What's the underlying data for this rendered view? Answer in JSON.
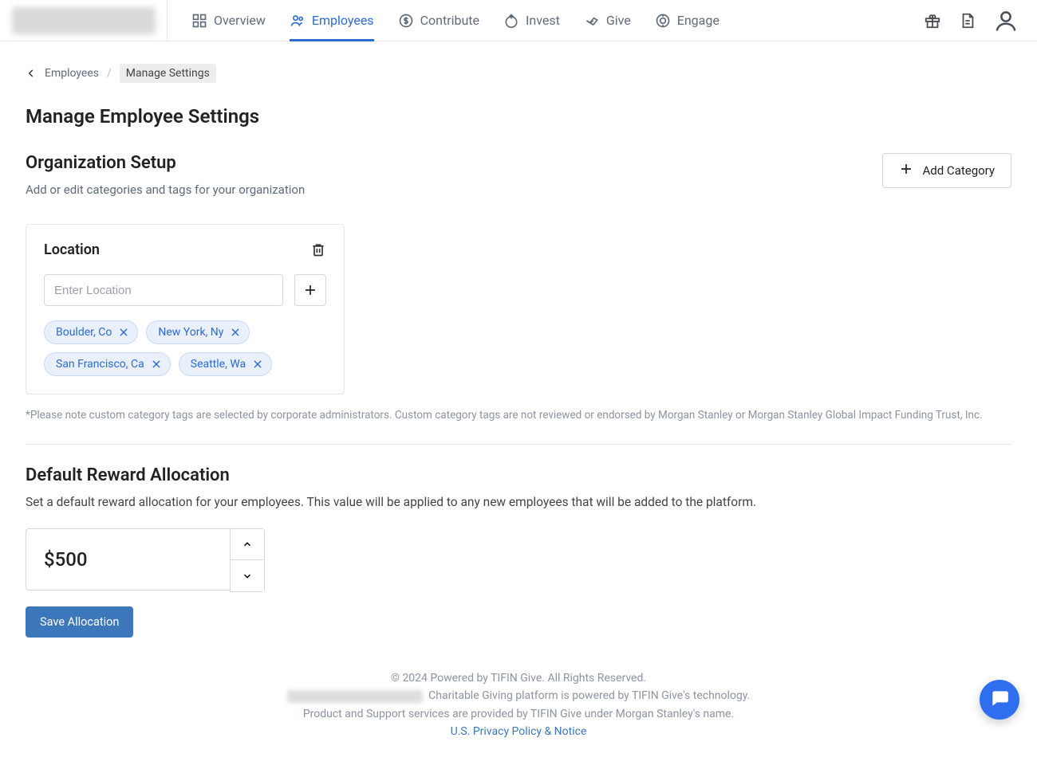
{
  "nav": {
    "tabs": [
      {
        "label": "Overview"
      },
      {
        "label": "Employees"
      },
      {
        "label": "Contribute"
      },
      {
        "label": "Invest"
      },
      {
        "label": "Give"
      },
      {
        "label": "Engage"
      }
    ],
    "active_tab_index": 1
  },
  "breadcrumb": {
    "parent": "Employees",
    "current": "Manage Settings"
  },
  "page_title": "Manage Employee Settings",
  "org_setup": {
    "title": "Organization Setup",
    "subtitle": "Add or edit categories and tags for your organization",
    "add_category_label": "Add Category",
    "card": {
      "title": "Location",
      "input_placeholder": "Enter Location",
      "tags": [
        "Boulder, Co",
        "New York, Ny",
        "San Francisco, Ca",
        "Seattle, Wa"
      ]
    },
    "disclaimer": "*Please note custom category tags are selected by corporate administrators. Custom category tags are not reviewed or endorsed by Morgan Stanley or Morgan Stanley Global Impact Funding Trust, Inc."
  },
  "default_reward": {
    "title": "Default Reward Allocation",
    "description": "Set a default reward allocation for your employees. This value will be applied to any new employees that will be added to the platform.",
    "value_display": "$500",
    "save_label": "Save Allocation"
  },
  "footer": {
    "line1": "© 2024 Powered by TIFIN Give. All Rights Reserved.",
    "line2_tail": "Charitable Giving platform is powered by TIFIN Give's technology.",
    "line3": "Product and Support services are provided by TIFIN Give under Morgan Stanley's name.",
    "privacy": "U.S. Privacy Policy & Notice"
  }
}
